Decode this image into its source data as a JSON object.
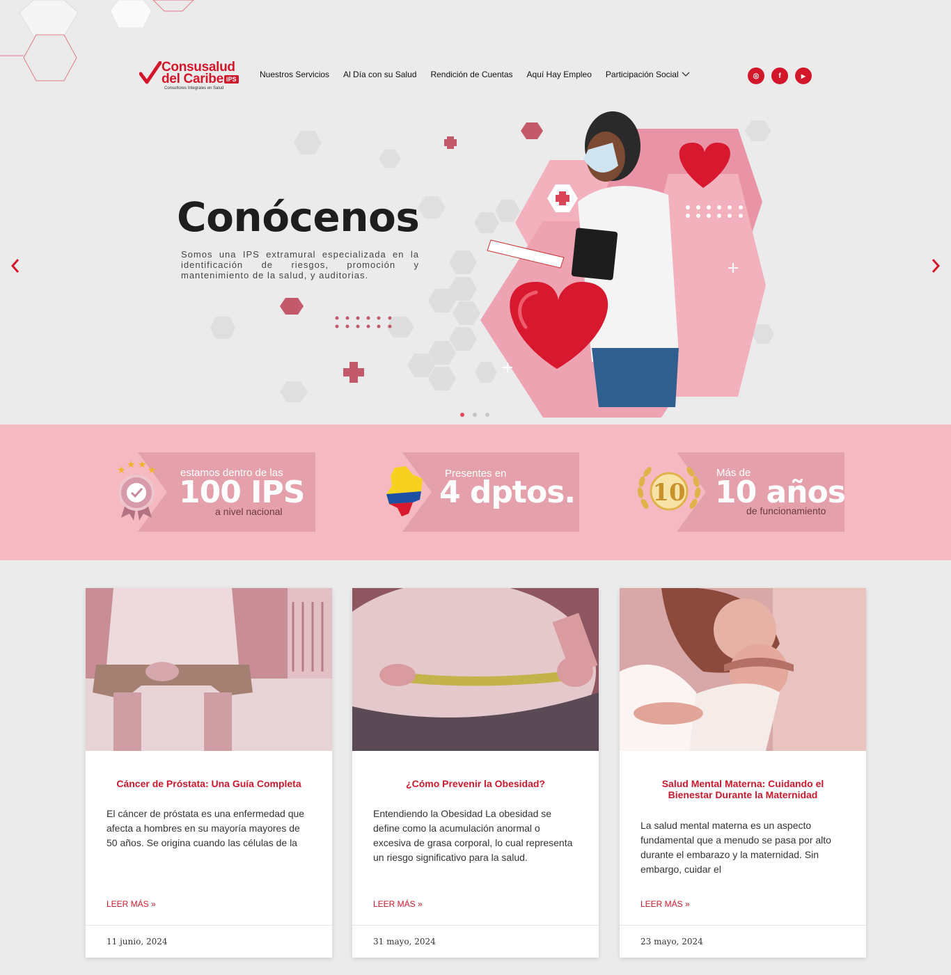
{
  "brand": {
    "name_line1": "Consusalud",
    "name_line2": "del Caribe",
    "badge": "IPS",
    "tagline": "Consultores Integrales en Salud"
  },
  "nav": {
    "items": [
      {
        "label": "Nuestros Servicios"
      },
      {
        "label": "Al Día con su Salud"
      },
      {
        "label": "Rendición de Cuentas"
      },
      {
        "label": "Aquí Hay Empleo"
      },
      {
        "label": "Participación Social"
      }
    ]
  },
  "social": {
    "instagram": "◎",
    "facebook": "f",
    "youtube": "▶"
  },
  "hero": {
    "title": "Conócenos",
    "text": "Somos una IPS extramural especializada en la identificación de riesgos, promoción y mantenimiento de la salud, y auditorias.",
    "prev_arrow": "‹",
    "next_arrow": "›",
    "active_slide": 1,
    "slide_count": 3
  },
  "stats": [
    {
      "top": "estamos dentro de las",
      "big": "100 IPS",
      "bottom": "a nivel nacional"
    },
    {
      "top": "Presentes en",
      "big": "4 dptos.",
      "bottom": ""
    },
    {
      "top": "Más de",
      "big": "10 años",
      "bottom": "de funcionamiento",
      "emblem": "10"
    }
  ],
  "cards": [
    {
      "title": "Cáncer de Próstata: Una Guía Completa",
      "excerpt": "El cáncer de próstata es una enfermedad que afecta a hombres en su mayoría mayores de 50 años. Se origina cuando las células de la",
      "more": "LEER MÁS »",
      "date": "11 junio, 2024"
    },
    {
      "title": "¿Cómo Prevenir la Obesidad?",
      "excerpt": "Entendiendo la Obesidad La obesidad se define como la acumulación anormal o excesiva de grasa corporal, lo cual representa un riesgo significativo para la salud.",
      "more": "LEER MÁS »",
      "date": "31 mayo, 2024"
    },
    {
      "title": "Salud Mental Materna: Cuidando el Bienestar Durante la Maternidad",
      "excerpt": "La salud mental materna es un aspecto fundamental que a menudo se pasa por alto durante el embarazo y la maternidad. Sin embargo, cuidar el",
      "more": "LEER MÁS »",
      "date": "23 mayo, 2024"
    }
  ],
  "colors": {
    "brand_red": "#d3172a",
    "stats_band": "#f4b9c1",
    "background": "#ebebeb"
  }
}
